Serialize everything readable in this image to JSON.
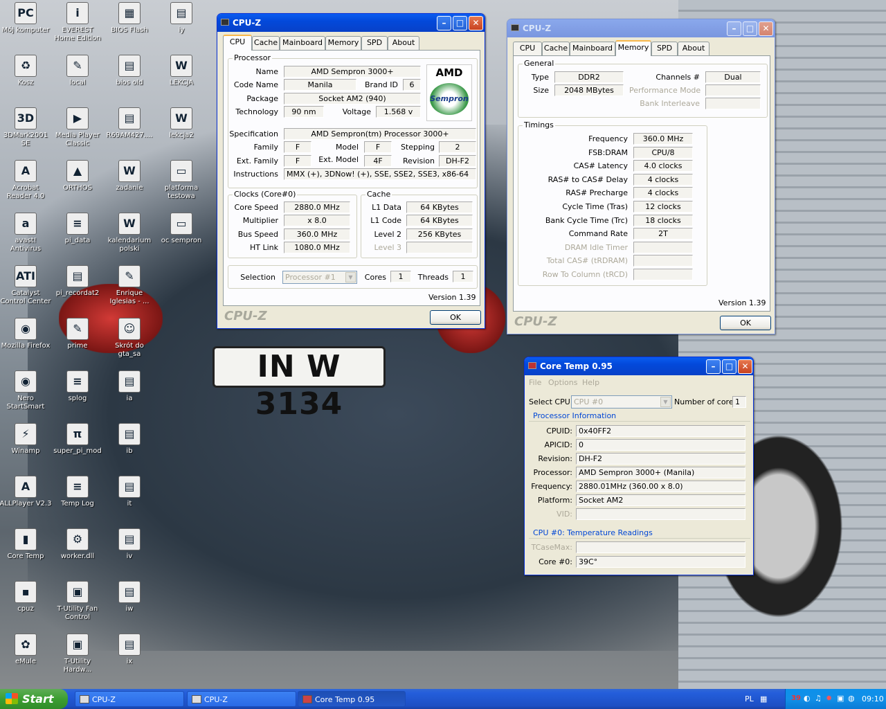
{
  "desktop": {
    "icons": [
      {
        "label": "Mój komputer",
        "g": "PC"
      },
      {
        "label": "EVEREST Home Edition",
        "g": "i"
      },
      {
        "label": "BIOS Flash",
        "g": "▦"
      },
      {
        "label": "iy",
        "g": "▤"
      },
      {
        "label": "Kosz",
        "g": "♻"
      },
      {
        "label": "local",
        "g": "✎"
      },
      {
        "label": "bios old",
        "g": "▤"
      },
      {
        "label": "LEKCJA",
        "g": "W"
      },
      {
        "label": "3DMark2001 SE",
        "g": "3D"
      },
      {
        "label": "Media Player Classic",
        "g": "▶"
      },
      {
        "label": "R69AM427....",
        "g": "▤"
      },
      {
        "label": "lekcja2",
        "g": "W"
      },
      {
        "label": "Acrobat Reader 4.0",
        "g": "A"
      },
      {
        "label": "ORTHOS",
        "g": "▲"
      },
      {
        "label": "zadanie",
        "g": "W"
      },
      {
        "label": "platforma testowa",
        "g": "▭"
      },
      {
        "label": "avast! Antivirus",
        "g": "a"
      },
      {
        "label": "pi_data",
        "g": "≡"
      },
      {
        "label": "kalendarium polski",
        "g": "W"
      },
      {
        "label": "oc sempron",
        "g": "▭"
      },
      {
        "label": "Catalyst Control Center",
        "g": "ATI"
      },
      {
        "label": "pi_recordat2",
        "g": "▤"
      },
      {
        "label": "Enrique Iglesias - ...",
        "g": "✎"
      },
      {
        "label": "Mozilla Firefox",
        "g": "◉"
      },
      {
        "label": "prime",
        "g": "✎"
      },
      {
        "label": "Skrót do gta_sa",
        "g": "☺"
      },
      {
        "label": "Nero StartSmart",
        "g": "◉"
      },
      {
        "label": "splog",
        "g": "≡"
      },
      {
        "label": "ia",
        "g": "▤"
      },
      {
        "label": "Winamp",
        "g": "⚡"
      },
      {
        "label": "super_pi_mod",
        "g": "π"
      },
      {
        "label": "ib",
        "g": "▤"
      },
      {
        "label": "ALLPlayer V2.3",
        "g": "A"
      },
      {
        "label": "Temp Log",
        "g": "≡"
      },
      {
        "label": "it",
        "g": "▤"
      },
      {
        "label": "Core Temp",
        "g": "▮"
      },
      {
        "label": "worker.dll",
        "g": "⚙"
      },
      {
        "label": "iv",
        "g": "▤"
      },
      {
        "label": "cpuz",
        "g": "▪"
      },
      {
        "label": "T-Utility Fan Control",
        "g": "▣"
      },
      {
        "label": "iw",
        "g": "▤"
      },
      {
        "label": "eMule",
        "g": "✿"
      },
      {
        "label": "T-Utility Hardw...",
        "g": "▣"
      },
      {
        "label": "ix",
        "g": "▤"
      }
    ],
    "plate": "IN W 3134"
  },
  "cpuz1": {
    "title": "CPU-Z",
    "tabs": [
      "CPU",
      "Cache",
      "Mainboard",
      "Memory",
      "SPD",
      "About"
    ],
    "processor": {
      "group": "Processor",
      "name_l": "Name",
      "name": "AMD Sempron 3000+",
      "code_l": "Code Name",
      "code": "Manila",
      "brand_l": "Brand ID",
      "brand": "6",
      "pkg_l": "Package",
      "pkg": "Socket AM2 (940)",
      "tech_l": "Technology",
      "tech": "90 nm",
      "volt_l": "Voltage",
      "volt": "1.568 v",
      "spec_l": "Specification",
      "spec": "AMD Sempron(tm) Processor 3000+",
      "fam_l": "Family",
      "fam": "F",
      "model_l": "Model",
      "model": "F",
      "step_l": "Stepping",
      "step": "2",
      "efam_l": "Ext. Family",
      "efam": "F",
      "emodel_l": "Ext. Model",
      "emodel": "4F",
      "rev_l": "Revision",
      "rev": "DH-F2",
      "instr_l": "Instructions",
      "instr": "MMX (+), 3DNow! (+), SSE, SSE2, SSE3, x86-64",
      "logo_amd": "AMD",
      "logo_sem": "Sempron"
    },
    "clocks": {
      "group": "Clocks (Core#0)",
      "cs_l": "Core Speed",
      "cs": "2880.0 MHz",
      "mul_l": "Multiplier",
      "mul": "x 8.0",
      "bus_l": "Bus Speed",
      "bus": "360.0 MHz",
      "ht_l": "HT Link",
      "ht": "1080.0 MHz"
    },
    "cache": {
      "group": "Cache",
      "l1d_l": "L1 Data",
      "l1d": "64 KBytes",
      "l1c_l": "L1 Code",
      "l1c": "64 KBytes",
      "l2_l": "Level 2",
      "l2": "256 KBytes",
      "l3_l": "Level 3"
    },
    "sel": {
      "sel_l": "Selection",
      "sel": "Processor #1",
      "cores_l": "Cores",
      "cores": "1",
      "thr_l": "Threads",
      "thr": "1"
    },
    "version": "Version 1.39",
    "brand": "CPU-Z",
    "ok": "OK"
  },
  "cpuz2": {
    "title": "CPU-Z",
    "tabs": [
      "CPU",
      "Cache",
      "Mainboard",
      "Memory",
      "SPD",
      "About"
    ],
    "general": {
      "group": "General",
      "type_l": "Type",
      "type": "DDR2",
      "size_l": "Size",
      "size": "2048 MBytes",
      "ch_l": "Channels #",
      "ch": "Dual",
      "pm_l": "Performance Mode",
      "bi_l": "Bank Interleave"
    },
    "timings": {
      "group": "Timings",
      "rows": [
        {
          "l": "Frequency",
          "v": "360.0 MHz",
          "d": false
        },
        {
          "l": "FSB:DRAM",
          "v": "CPU/8",
          "d": false
        },
        {
          "l": "CAS# Latency",
          "v": "4.0 clocks",
          "d": false
        },
        {
          "l": "RAS# to CAS# Delay",
          "v": "4 clocks",
          "d": false
        },
        {
          "l": "RAS# Precharge",
          "v": "4 clocks",
          "d": false
        },
        {
          "l": "Cycle Time (Tras)",
          "v": "12 clocks",
          "d": false
        },
        {
          "l": "Bank Cycle Time (Trc)",
          "v": "18 clocks",
          "d": false
        },
        {
          "l": "Command Rate",
          "v": "2T",
          "d": false
        },
        {
          "l": "DRAM Idle Timer",
          "v": "",
          "d": true
        },
        {
          "l": "Total CAS# (tRDRAM)",
          "v": "",
          "d": true
        },
        {
          "l": "Row To Column (tRCD)",
          "v": "",
          "d": true
        }
      ]
    },
    "version": "Version 1.39",
    "brand": "CPU-Z",
    "ok": "OK"
  },
  "coretemp": {
    "title": "Core Temp 0.95",
    "menu": [
      "File",
      "Options",
      "Help"
    ],
    "selcpu_l": "Select CPU:",
    "selcpu": "CPU #0",
    "ncores_l": "Number of cores",
    "ncores": "1",
    "pi": "Processor Information",
    "rows": [
      {
        "l": "CPUID:",
        "v": "0x40FF2"
      },
      {
        "l": "APICID:",
        "v": "0"
      },
      {
        "l": "Revision:",
        "v": "DH-F2"
      },
      {
        "l": "Processor:",
        "v": "AMD Sempron 3000+ (Manila)"
      },
      {
        "l": "Frequency:",
        "v": "2880.01MHz (360.00 x 8.0)"
      },
      {
        "l": "Platform:",
        "v": "Socket AM2"
      },
      {
        "l": "VID:",
        "v": ""
      }
    ],
    "tr": "CPU #0: Temperature Readings",
    "tcase_l": "TCaseMax:",
    "core0_l": "Core #0:",
    "core0": "39C°"
  },
  "taskbar": {
    "start": "Start",
    "buttons": [
      "CPU-Z",
      "CPU-Z",
      "Core Temp 0.95"
    ],
    "lang": "PL",
    "tray_temp": "39",
    "clock": "09:10"
  }
}
